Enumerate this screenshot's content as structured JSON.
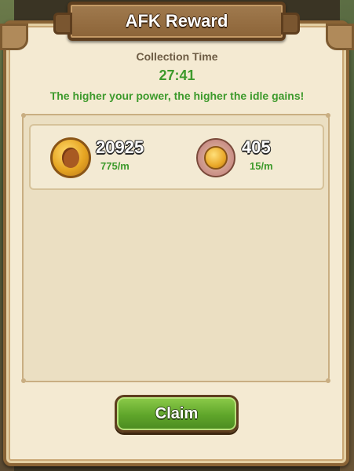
{
  "dialog": {
    "title": "AFK Reward",
    "collection_label": "Collection Time",
    "collection_time": "27:41",
    "hint": "The higher your power, the higher the idle gains!"
  },
  "rewards": [
    {
      "icon": "gold-coin-icon",
      "amount": "20925",
      "rate": "775/m"
    },
    {
      "icon": "medal-icon",
      "amount": "405",
      "rate": "15/m"
    }
  ],
  "claim_button": {
    "label": "Claim"
  },
  "colors": {
    "parchment": "#f4ead2",
    "frame_brown": "#8a6436",
    "accent_green": "#3d9a2c",
    "button_green": "#5fa52a"
  }
}
